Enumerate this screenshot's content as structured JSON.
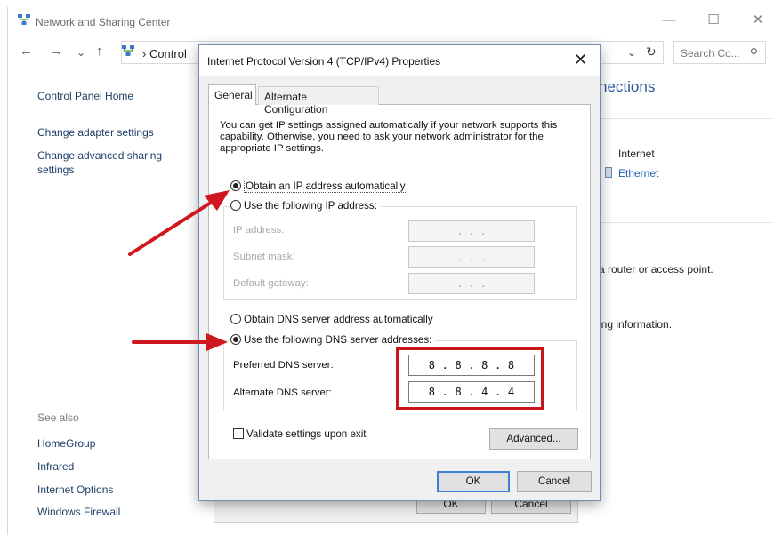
{
  "window": {
    "title": "Network and Sharing Center",
    "controls": [
      "—",
      "☐",
      "✕"
    ]
  },
  "nav": {
    "back": "←",
    "forward": "→",
    "recent": "⌄",
    "up": "↑",
    "crumb": "› Control",
    "dropdown": "⌄",
    "refresh": "↻",
    "search_placeholder": "Search Co...",
    "search_icon_glyph": "⚲"
  },
  "sidebar": {
    "home": "Control Panel Home",
    "links": [
      "Change adapter settings",
      "Change advanced sharing",
      "settings"
    ],
    "see_also": "See also",
    "see_also_links": [
      "HomeGroup",
      "Infrared",
      "Internet Options",
      "Windows Firewall"
    ]
  },
  "main": {
    "heading_fragment": "nections",
    "access_label": "Internet",
    "connection_link": "Ethernet",
    "text1": "a router or access point.",
    "text2": "ing information."
  },
  "background_buttons": {
    "ok": "OK",
    "cancel": "Cancel"
  },
  "dialog": {
    "title": "Internet Protocol Version 4 (TCP/IPv4) Properties",
    "close_glyph": "✕",
    "tabs": [
      "General",
      "Alternate Configuration"
    ],
    "intro": "You can get IP settings assigned automatically if your network supports this capability. Otherwise, you need to ask your network administrator for the appropriate IP settings.",
    "ip_mode": {
      "auto_label": "Obtain an IP address automatically",
      "manual_label": "Use the following IP address:",
      "selected": "auto"
    },
    "ip_fields": {
      "ip_address_label": "IP address:",
      "subnet_label": "Subnet mask:",
      "gateway_label": "Default gateway:",
      "empty_value": ".   .   ."
    },
    "dns_mode": {
      "auto_label": "Obtain DNS server address automatically",
      "manual_label": "Use the following DNS server addresses:",
      "selected": "manual"
    },
    "dns_fields": {
      "preferred_label": "Preferred DNS server:",
      "preferred_value": [
        "8",
        "8",
        "8",
        "8"
      ],
      "alternate_label": "Alternate DNS server:",
      "alternate_value": [
        "8",
        "8",
        "4",
        "4"
      ]
    },
    "validate_label": "Validate settings upon exit",
    "validate_checked": false,
    "advanced_label": "Advanced...",
    "ok_label": "OK",
    "cancel_label": "Cancel"
  },
  "annotations": {
    "arrow_color": "#d0161e",
    "highlight_color": "#c8141b"
  }
}
